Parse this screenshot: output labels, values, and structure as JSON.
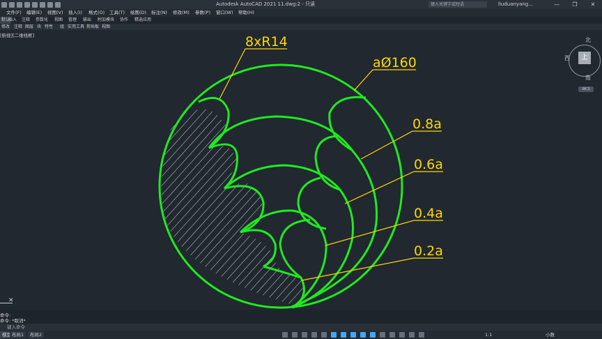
{
  "window": {
    "app_title": "Autodesk AutoCAD 2021    11.dwg:2 - 只读",
    "search_placeholder": "键入关键字或短语",
    "user": "liuduanyang...",
    "controls": [
      "—",
      "❐",
      "✕"
    ]
  },
  "menu": [
    "文件(F)",
    "编辑(E)",
    "视图(V)",
    "插入(I)",
    "格式(O)",
    "工具(T)",
    "绘图(D)",
    "标注(N)",
    "修改(M)",
    "参数(P)",
    "窗口(W)",
    "帮助(H)"
  ],
  "ribbon_tabs": [
    "默认",
    "插入",
    "注释",
    "参数化",
    "视图",
    "管理",
    "输出",
    "附加模块",
    "协作",
    "精选应用"
  ],
  "ribbon_panels": [
    "修改",
    "注释",
    "图层",
    "块",
    "特性",
    "组",
    "实用工具",
    "剪贴板",
    "视图"
  ],
  "view_label": "[俯视][二维线框]",
  "viewcube": {
    "north": "北",
    "west": "西",
    "south": "南",
    "face": "上",
    "wcs": "WCS"
  },
  "drawing": {
    "labels": [
      "8xR14",
      "aØ160",
      "0.8a",
      "0.6a",
      "0.4a",
      "0.2a"
    ]
  },
  "command": {
    "line1": "命令:",
    "line2": "命令: *取消*",
    "placeholder": "键入命令"
  },
  "status": {
    "tabs": [
      "模型",
      "布局1",
      "布局2"
    ],
    "zoom": "1:1",
    "units": "小数"
  },
  "colors": {
    "geometry": "#1fea1f",
    "annotation": "#ffd800",
    "background": "#212830"
  }
}
